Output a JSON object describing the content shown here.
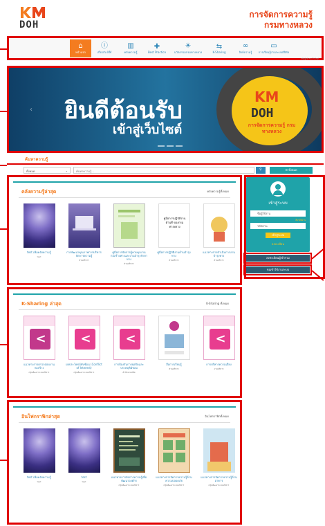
{
  "header": {
    "logo_km": "KM",
    "logo_doh": "DOH",
    "title_line1": "การจัดการความรู้",
    "title_line2": "กรมทางหลวง"
  },
  "nav": {
    "items": [
      {
        "label": "หน้าแรก",
        "icon": "home-icon",
        "glyph": "⌂"
      },
      {
        "label": "เกี่ยวกับ KM",
        "icon": "info-icon",
        "glyph": "ⓘ"
      },
      {
        "label": "คลังความรู้",
        "icon": "book-icon",
        "glyph": "▥"
      },
      {
        "label": "Best Practice",
        "icon": "thumbs-up-icon",
        "glyph": "👍"
      },
      {
        "label": "นวัตกรรมกรมทางหลวง",
        "icon": "lightbulb-icon",
        "glyph": "💡"
      },
      {
        "label": "K-Sharing",
        "icon": "share-icon",
        "glyph": "⇆"
      },
      {
        "label": "ลิงก์ความรู้",
        "icon": "link-icon",
        "glyph": "🔗"
      },
      {
        "label": "การเรียนรู้ผ่านระบบดิจิทัล",
        "icon": "laptop-icon",
        "glyph": "💻"
      }
    ],
    "visitor_text": "สถิติผู้เข้าชมเว็บไซต์"
  },
  "banner": {
    "welcome": "ยินดีต้อนรับ",
    "subtitle": "เข้าสู่เว็บไซต์",
    "logo_km": "KM",
    "logo_doh": "DOH",
    "logo_text": "การจัดการความรู้ กรมทางหลวง"
  },
  "search": {
    "title": "ค้นหาความรู้",
    "select_value": "ทั้งหมด",
    "placeholder": "ค้นหาความรู้...",
    "all_label": "ทั้งหมด"
  },
  "sections": {
    "latest_knowledge": {
      "title": "คลังความรู้ล่าสุด",
      "more": "คลังความรู้ทั้งหมด",
      "cards": [
        {
          "title": "test เพิ่มคลังความรู้",
          "sub": "test",
          "thumb": "galaxy"
        },
        {
          "title": "การพัฒนาคุณภาพการบริหารจัดการความรู้",
          "sub": "ส่วนบริหาร",
          "thumb": "purple"
        },
        {
          "title": "คู่มือการจัดการผู้ควบคุมงานก่อสร้างทางและงานบำรุงรักษาทาง",
          "sub": "ส่วนบริหาร",
          "thumb": "green"
        },
        {
          "title": "คู่มือการปฏิบัติงานด้านบำรุงทาง",
          "sub": "ส่วนบริหาร",
          "thumb": "doc",
          "thumb_text": "คู่มือการปฏิบัติงาน ด้านที่ ของกรมทางหลวง"
        },
        {
          "title": "แนวทางการดำเนินการงานบำรุงทาง",
          "sub": "ส่วนบริหาร",
          "thumb": "doc"
        }
      ]
    },
    "ksharing": {
      "title": "K-Sharing ล่าสุด",
      "more": "K-Sharing ทั้งหมด",
      "cards": [
        {
          "title": "แนวทางการตรวจสอบงานก่อสร้าง",
          "sub": "กลุ่มพัฒนาระบบบริหาร",
          "thumb": "kshare"
        },
        {
          "title": "ผลประโยชน์ทับซ้อน (Conflict of Interest)",
          "sub": "กลุ่มพัฒนาระบบบริหาร",
          "thumb": "kshare pink"
        },
        {
          "title": "การป้องกันการทุจริตและประพฤติมิชอบ",
          "sub": "สำนักงานปลัด",
          "thumb": "kshare pink"
        },
        {
          "title": "สื่อการเรียนรู้",
          "sub": "ส่วนบริหาร",
          "thumb": "doc"
        },
        {
          "title": "การบริหารความเสี่ยง",
          "sub": "งานบริหาร",
          "thumb": "kshare pink"
        }
      ]
    },
    "info": {
      "title": "อินโฟกราฟิกล่าสุด",
      "more": "อินโฟกราฟิกทั้งหมด",
      "cards": [
        {
          "title": "test เพิ่มคลังความรู้",
          "sub": "test",
          "thumb": "galaxy"
        },
        {
          "title": "test",
          "sub": "test",
          "thumb": "galaxy"
        },
        {
          "title": "แนวทางการจัดการความรู้เพื่อพัฒนาองค์กร",
          "sub": "กลุ่มพัฒนาระบบบริหาร",
          "thumb": "chalk"
        },
        {
          "title": "แนวทางการจัดการความรู้ด้านความปลอดภัย",
          "sub": "กลุ่มพัฒนาระบบบริหาร",
          "thumb": "board"
        },
        {
          "title": "แนวทางการจัดการความรู้ด้านอาคาร",
          "sub": "กลุ่มพัฒนาระบบบริหาร",
          "thumb": "bldg"
        }
      ]
    }
  },
  "sidebar": {
    "login_title": "เข้าสู่ระบบ",
    "username_placeholder": "ชื่อผู้ใช้งาน",
    "forgot": "ลืมรหัสผ่าน",
    "password_placeholder": "รหัสผ่าน",
    "login_btn": "เข้าสู่ระบบ",
    "register": "ลงทะเบียน",
    "btn1": "ลงทะเบียนผู้เข้าร่วม",
    "btn2": "ขอเข้าใช้งานระบบ"
  }
}
